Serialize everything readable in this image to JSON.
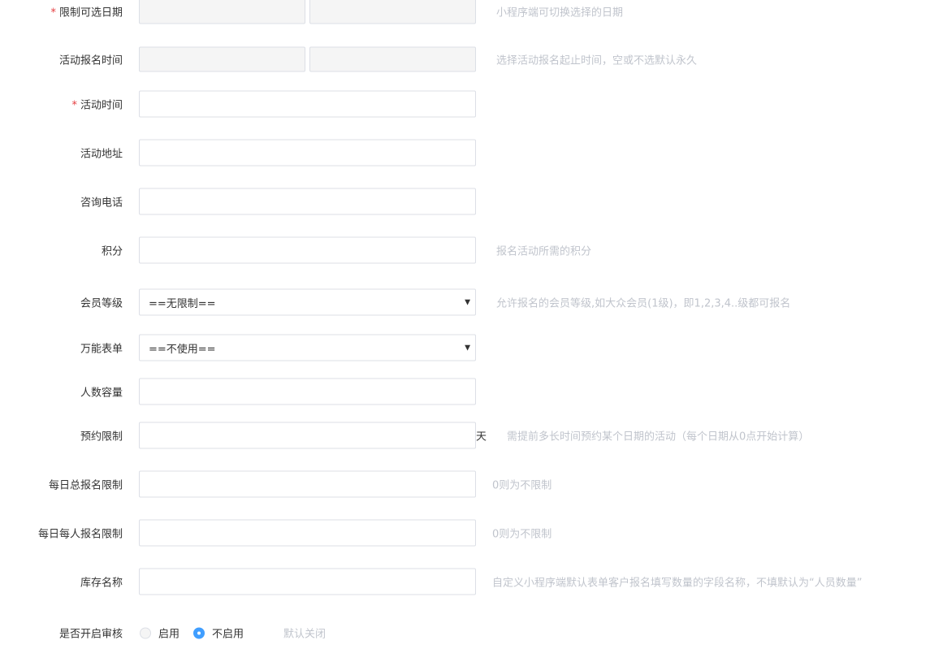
{
  "form": {
    "selectable_dates": {
      "label": "限制可选日期",
      "required": "*",
      "hint": "小程序端可切换选择的日期"
    },
    "signup_time": {
      "label": "活动报名时间",
      "hint": "选择活动报名起止时间，空或不选默认永久"
    },
    "activity_time": {
      "label": "活动时间",
      "required": "*"
    },
    "address": {
      "label": "活动地址"
    },
    "phone": {
      "label": "咨询电话"
    },
    "points": {
      "label": "积分",
      "hint": "报名活动所需的积分"
    },
    "member_level": {
      "label": "会员等级",
      "selected": "==无限制==",
      "hint": "允许报名的会员等级,如大众会员(1级)，即1,2,3,4..级都可报名"
    },
    "universal_form": {
      "label": "万能表单",
      "selected": "==不使用=="
    },
    "capacity": {
      "label": "人数容量"
    },
    "booking_limit": {
      "label": "预约限制",
      "unit": "天",
      "hint": "需提前多长时间预约某个日期的活动（每个日期从0点开始计算）"
    },
    "daily_total_limit": {
      "label": "每日总报名限制",
      "hint": "0则为不限制"
    },
    "daily_person_limit": {
      "label": "每日每人报名限制",
      "hint": "0则为不限制"
    },
    "stock_name": {
      "label": "库存名称",
      "hint": "自定义小程序端默认表单客户报名填写数量的字段名称，不填默认为“人员数量”"
    },
    "audit": {
      "label": "是否开启审核",
      "options": [
        "启用",
        "不启用"
      ],
      "selected_index": 1,
      "hint": "默认关闭"
    }
  }
}
